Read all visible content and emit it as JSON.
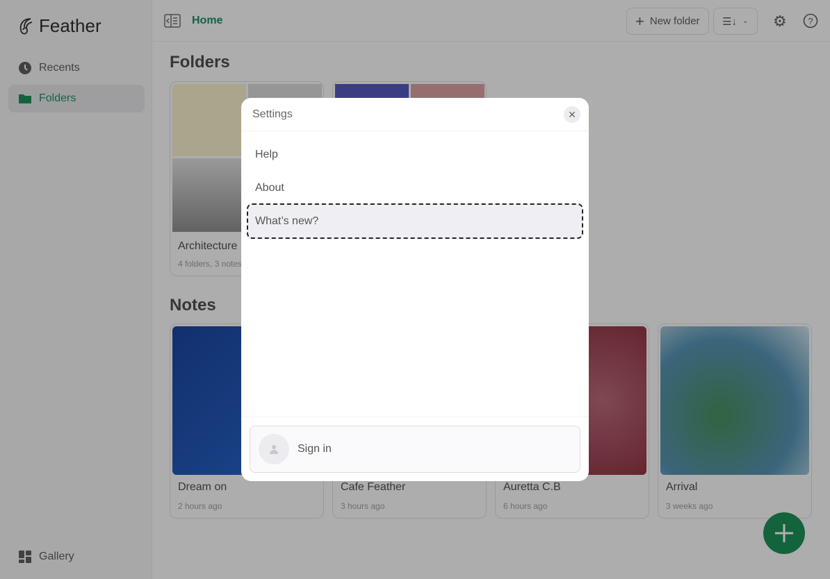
{
  "app": {
    "name": "Feather"
  },
  "sidebar": {
    "items": [
      {
        "label": "Recents",
        "icon": "clock-icon"
      },
      {
        "label": "Folders",
        "icon": "folder-icon",
        "active": true
      }
    ],
    "bottom": {
      "label": "Gallery",
      "icon": "gallery-icon"
    }
  },
  "header": {
    "breadcrumb": "Home",
    "new_folder": "New folder"
  },
  "main": {
    "folders_title": "Folders",
    "folders": [
      {
        "title": "Architecture",
        "subtitle": "4 folders, 3 notes"
      },
      {
        "title": "",
        "subtitle": ""
      }
    ],
    "notes_title": "Notes",
    "notes": [
      {
        "title": "Dream on",
        "subtitle": "2 hours ago"
      },
      {
        "title": "Cafe Feather",
        "subtitle": "3 hours ago"
      },
      {
        "title": "Auretta C.B",
        "subtitle": "6 hours ago"
      },
      {
        "title": "Arrival",
        "subtitle": "3 weeks ago"
      }
    ]
  },
  "modal": {
    "title": "Settings",
    "items": [
      "Help",
      "About",
      "What’s new?"
    ],
    "sign_in": "Sign in"
  },
  "colors": {
    "accent": "#0e8a4f"
  }
}
